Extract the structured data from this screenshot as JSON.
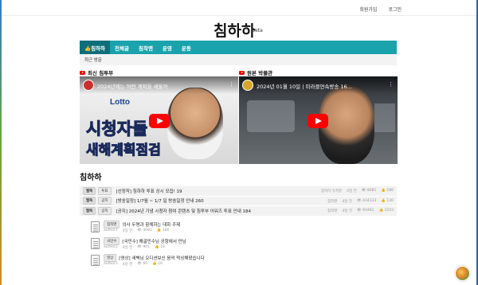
{
  "topbar": {
    "signup": "회원가입",
    "login": "로그인"
  },
  "logo": {
    "text": "침하하",
    "beta": "Beta"
  },
  "nav": {
    "items": [
      {
        "label": "👍침하하",
        "active": true
      },
      {
        "label": "전체글"
      },
      {
        "label": "침착맨"
      },
      {
        "label": "운영"
      },
      {
        "label": "운동"
      }
    ]
  },
  "subnav": {
    "label": "최근 방문"
  },
  "videos": [
    {
      "section": "최신 침투부",
      "caption": "2024년에는 어떤 계획을 세울까",
      "brand": "Lotto",
      "overlay1": "시청자들",
      "overlay2": "새해계획점검"
    },
    {
      "section": "원본 박물관",
      "caption": "2024년 01월 10일 | 미라클연속방송 16..."
    }
  ],
  "board": {
    "title": "침하하",
    "notices": [
      {
        "badge1": "필독",
        "badge2": "투표",
        "title": "[선정작] 침하하 투표 상시 모집! 19",
        "author": "침하하 유저봇",
        "time": "4일 전",
        "views": "8081",
        "likes": "180"
      },
      {
        "badge1": "필독",
        "badge2": "공지",
        "title": "[방송일정] 1/7월 ~ 1/7 일 방송일정 안내 260",
        "author": "침착맨",
        "time": "4일 전",
        "views": "434333",
        "likes": "130"
      },
      {
        "badge1": "필독",
        "badge2": "공지",
        "title": "[공지] 2024년 기념 시청자 참여 콘텐츠 및 침투부 어워즈 투표 안내 184",
        "author": "침착맨",
        "time": "4일 전",
        "views": "60481",
        "likes": "2243"
      }
    ],
    "posts": [
      {
        "tag": "침착맨",
        "title": "의사 두명과 함께하는 대화 주제",
        "author": "author1",
        "time": "4일 전",
        "views": "4081",
        "likes": "180"
      },
      {
        "tag": "국민수",
        "title": "[국민수] 해골민수님 공항에서 만남",
        "author": "author2",
        "time": "4일 전",
        "views": "901",
        "likes": "18"
      },
      {
        "tag": "영상",
        "title": "[영상] 새벽님 오디션보신 음악 먹싱해왔습니다",
        "author": "author3",
        "time": "4일 전",
        "views": "60",
        "likes": "16"
      }
    ]
  }
}
